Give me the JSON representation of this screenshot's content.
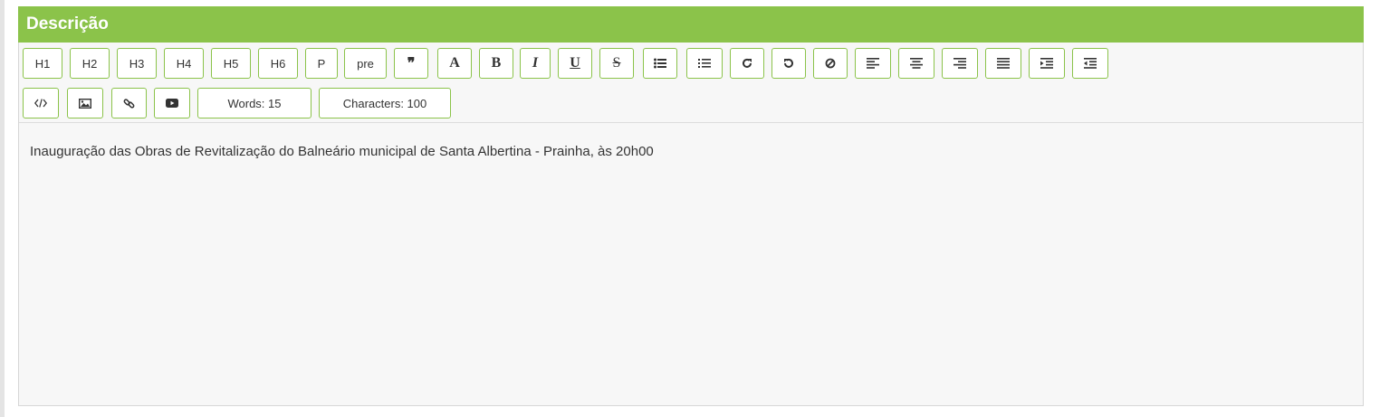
{
  "panel": {
    "title": "Descrição"
  },
  "toolbar": {
    "h1": "H1",
    "h2": "H2",
    "h3": "H3",
    "h4": "H4",
    "h5": "H5",
    "h6": "H6",
    "p": "P",
    "pre": "pre",
    "quote": "❞",
    "font": "A",
    "bold": "B",
    "italic": "I",
    "underline": "U",
    "strike": "S",
    "words": "Words: 15",
    "characters": "Characters: 100"
  },
  "icons": [
    "quote-icon",
    "font-icon",
    "bold-icon",
    "italic-icon",
    "underline-icon",
    "strikethrough-icon",
    "unordered-list-icon",
    "ordered-list-icon",
    "redo-icon",
    "undo-icon",
    "remove-format-icon",
    "align-left-icon",
    "align-center-icon",
    "align-right-icon",
    "align-justify-icon",
    "indent-icon",
    "outdent-icon",
    "code-icon",
    "image-icon",
    "link-icon",
    "video-icon"
  ],
  "editor": {
    "content": "Inauguração das Obras de Revitalização do Balneário municipal de Santa Albertina - Prainha, às 20h00"
  },
  "colors": {
    "accent": "#8bc34a",
    "panel_bg": "#f7f7f7"
  }
}
